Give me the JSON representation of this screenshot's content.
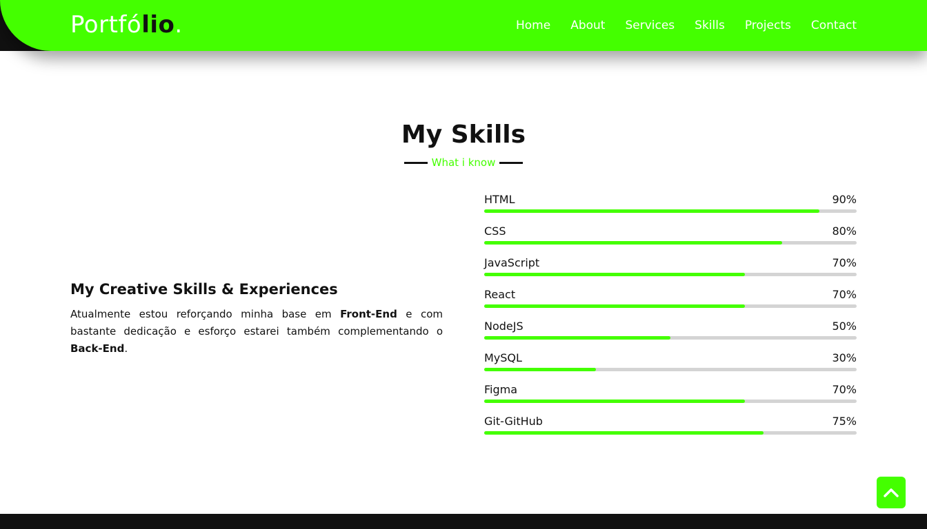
{
  "brand": {
    "logo_main": "Portfó",
    "logo_accent": "lio",
    "logo_dot": "."
  },
  "nav": {
    "items": [
      "Home",
      "About",
      "Services",
      "Skills",
      "Projects",
      "Contact"
    ]
  },
  "section": {
    "title": "My Skills",
    "subtitle": "What i know"
  },
  "intro": {
    "heading": "My Creative Skills & Experiences",
    "text_before": "Atualmente estou reforçando minha base em ",
    "bold1": "Front-End",
    "text_middle": " e com bastante dedicação e esforço estarei também complementando o ",
    "bold2": "Back-End",
    "text_after": "."
  },
  "skills": [
    {
      "name": "HTML",
      "percent_label": "90%",
      "value": 90
    },
    {
      "name": "CSS",
      "percent_label": "80%",
      "value": 80
    },
    {
      "name": "JavaScript",
      "percent_label": "70%",
      "value": 70
    },
    {
      "name": "React",
      "percent_label": "70%",
      "value": 70
    },
    {
      "name": "NodeJS",
      "percent_label": "50%",
      "value": 50
    },
    {
      "name": "MySQL",
      "percent_label": "30%",
      "value": 30
    },
    {
      "name": "Figma",
      "percent_label": "70%",
      "value": 70
    },
    {
      "name": "Git-GitHub",
      "percent_label": "75%",
      "value": 75
    }
  ],
  "colors": {
    "accent": "#44ff00",
    "dark": "#111111",
    "track": "#d4d4d4"
  },
  "scroll_top_icon": "chevron-up-icon"
}
